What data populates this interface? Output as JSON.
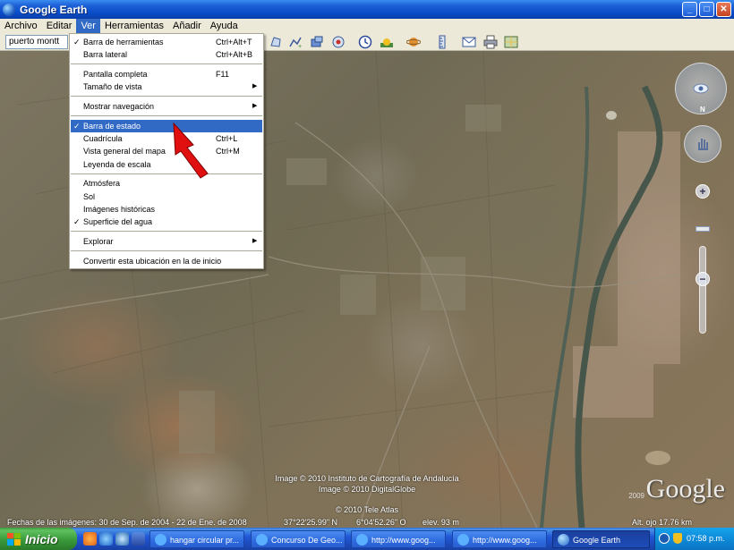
{
  "window": {
    "title": "Google Earth",
    "min": "_",
    "max": "□",
    "close": "✕"
  },
  "menubar": [
    "Archivo",
    "Editar",
    "Ver",
    "Herramientas",
    "Añadir",
    "Ayuda"
  ],
  "toolbar": {
    "search_value": "puerto montt"
  },
  "ver_menu": {
    "items": [
      {
        "label": "Barra de herramientas",
        "shortcut": "Ctrl+Alt+T",
        "checked": true
      },
      {
        "label": "Barra lateral",
        "shortcut": "Ctrl+Alt+B",
        "checked": false
      },
      {
        "label": "Pantalla completa",
        "shortcut": "F11",
        "checked": false
      },
      {
        "label": "Tamaño de vista",
        "submenu": true
      },
      {
        "label": "Mostrar navegación",
        "submenu": true
      },
      {
        "label": "Barra de estado",
        "checked": true,
        "highlighted": true
      },
      {
        "label": "Cuadrícula",
        "shortcut": "Ctrl+L",
        "checked": false
      },
      {
        "label": "Vista general del mapa",
        "shortcut": "Ctrl+M",
        "checked": false
      },
      {
        "label": "Leyenda de escala",
        "checked": false
      },
      {
        "label": "Atmósfera",
        "checked": false
      },
      {
        "label": "Sol",
        "checked": false
      },
      {
        "label": "Imágenes históricas",
        "checked": false
      },
      {
        "label": "Superficie del agua",
        "checked": true
      },
      {
        "label": "Explorar",
        "submenu": true
      },
      {
        "label": "Convertir esta ubicación en la de inicio"
      }
    ],
    "check_glyph": "✓",
    "submenu_glyph": "▶"
  },
  "map": {
    "attribution_1": "Image © 2010 Instituto de Cartografía de Andalucía",
    "attribution_2": "Image © 2010 DigitalGlobe",
    "attribution_3": "© 2010 Tele Atlas",
    "logo": "Google",
    "logo_year": "2009",
    "nav_north": "N",
    "zoom_in": "+",
    "zoom_out": "−"
  },
  "statusbar": {
    "dates": "Fechas de las imágenes: 30 de Sep. de 2004 - 22 de Ene. de 2008",
    "lat": "37°22'25.99\" N",
    "lon": "6°04'52.26\" O",
    "elev": "elev.  93 m",
    "eye_alt": "Alt. ojo  17.76 km"
  },
  "taskbar": {
    "start_label": "Inicio",
    "tasks": [
      {
        "label": "hangar circular pr...",
        "active": false
      },
      {
        "label": "Concurso De Geo...",
        "active": false
      },
      {
        "label": "http://www.goog...",
        "active": false
      },
      {
        "label": "http://www.goog...",
        "active": false
      },
      {
        "label": "Google Earth",
        "active": true
      }
    ],
    "clock": "07:58 p.m."
  }
}
